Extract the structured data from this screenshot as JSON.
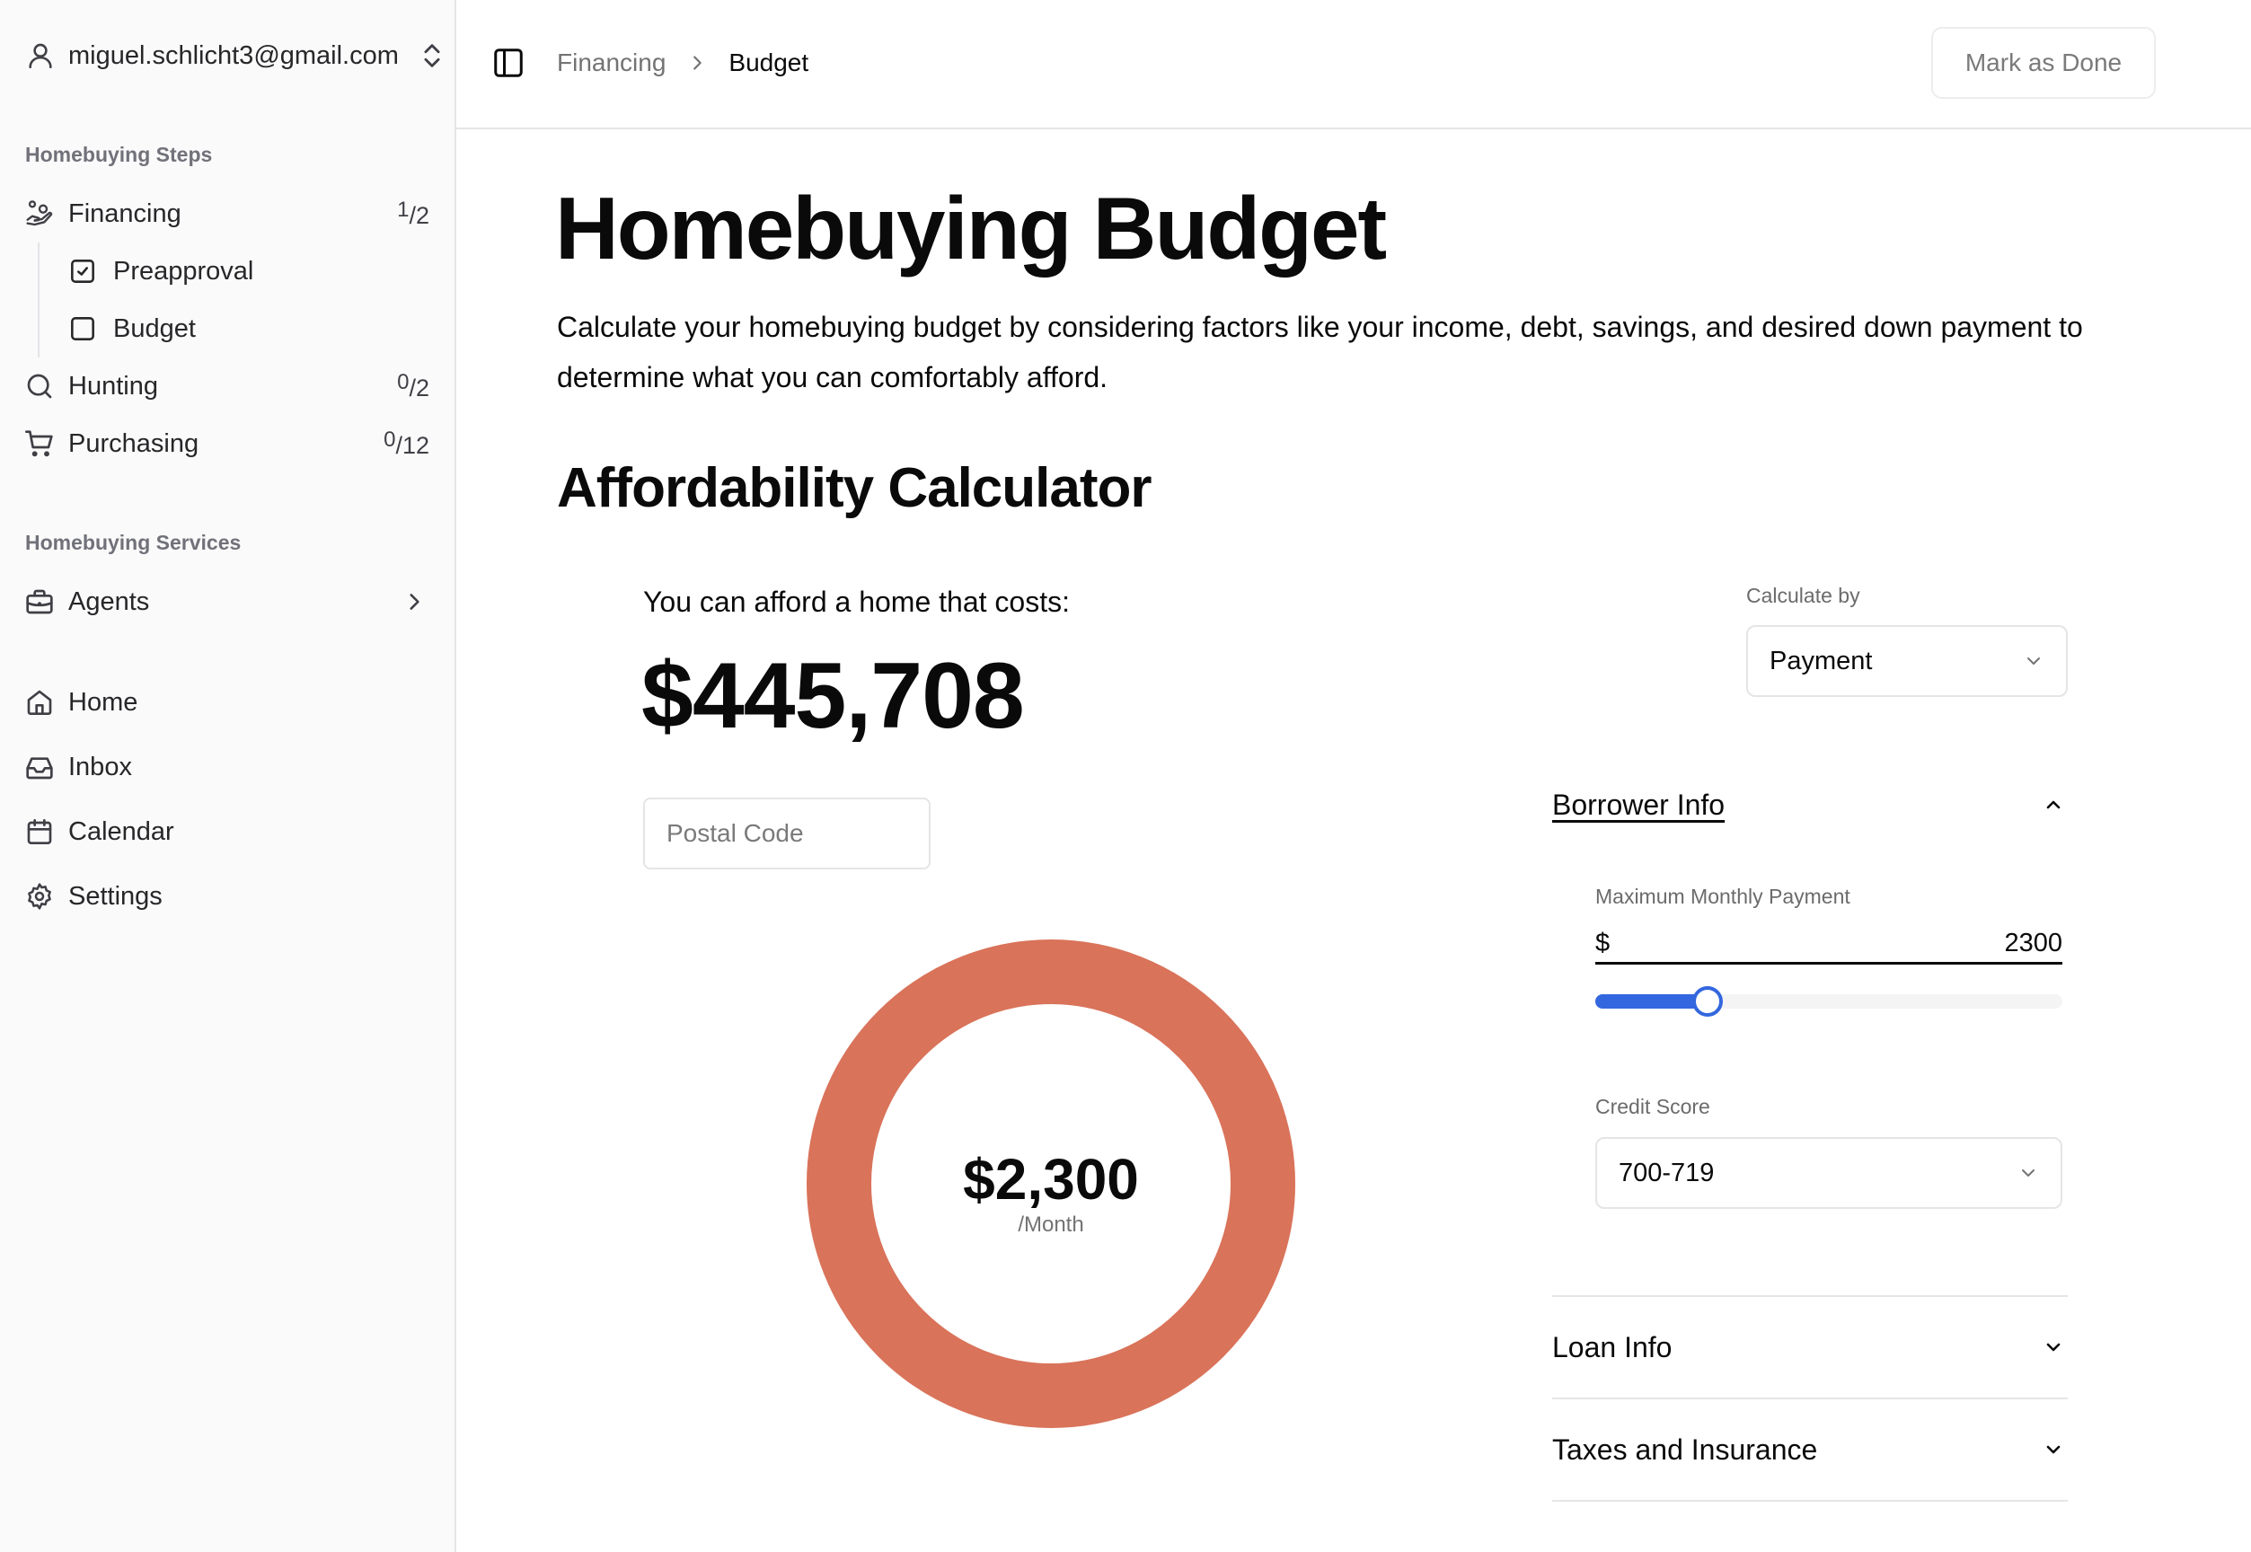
{
  "sidebar": {
    "user_email": "miguel.schlicht3@gmail.com",
    "steps_label": "Homebuying Steps",
    "steps": [
      {
        "label": "Financing",
        "done": "1",
        "total": "2",
        "icon": "hand-coins-icon"
      },
      {
        "label": "Hunting",
        "done": "0",
        "total": "2",
        "icon": "search-icon"
      },
      {
        "label": "Purchasing",
        "done": "0",
        "total": "12",
        "icon": "cart-icon"
      }
    ],
    "financing_substeps": [
      {
        "label": "Preapproval",
        "checked": true
      },
      {
        "label": "Budget",
        "checked": false
      }
    ],
    "services_label": "Homebuying Services",
    "services": [
      {
        "label": "Agents",
        "icon": "briefcase-icon"
      }
    ],
    "nav": [
      {
        "label": "Home",
        "icon": "home-icon"
      },
      {
        "label": "Inbox",
        "icon": "inbox-icon"
      },
      {
        "label": "Calendar",
        "icon": "calendar-icon"
      },
      {
        "label": "Settings",
        "icon": "gear-icon"
      }
    ]
  },
  "header": {
    "breadcrumb": {
      "parent": "Financing",
      "current": "Budget"
    },
    "mark_done_label": "Mark as Done"
  },
  "page": {
    "title": "Homebuying Budget",
    "description": "Calculate your homebuying budget by considering factors like your income, debt, savings, and desired down payment to determine what you can comfortably afford.",
    "section_title": "Affordability Calculator"
  },
  "calculator": {
    "afford_label": "You can afford a home that costs:",
    "afford_value": "$445,708",
    "postal_placeholder": "Postal Code",
    "postal_value": "",
    "monthly_amount": "$2,300",
    "monthly_unit": "/Month",
    "donut_color": "#d9735a",
    "calculate_by_label": "Calculate by",
    "calculate_by_value": "Payment",
    "sections": {
      "borrower": {
        "label": "Borrower Info",
        "expanded": true
      },
      "loan": {
        "label": "Loan Info",
        "expanded": false
      },
      "taxes": {
        "label": "Taxes and Insurance",
        "expanded": false
      }
    },
    "max_payment_label": "Maximum Monthly Payment",
    "currency_symbol": "$",
    "max_payment_value": "2300",
    "slider_fraction": 0.24,
    "slider_color": "#3367df",
    "credit_score_label": "Credit Score",
    "credit_score_value": "700-719"
  }
}
